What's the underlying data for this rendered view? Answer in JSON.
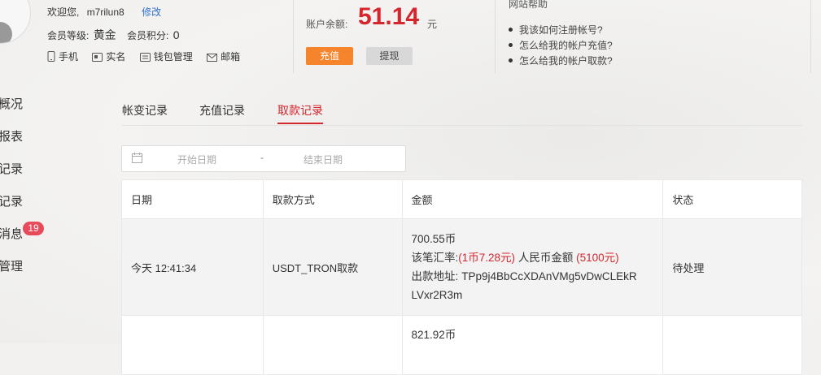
{
  "user": {
    "welcome": "欢迎您,",
    "username": "m7rilun8",
    "edit_link": "修改",
    "level_label": "会员等级:",
    "level_value": "黄金",
    "points_label": "会员积分:",
    "points_value": "0",
    "links": [
      "手机",
      "实名",
      "钱包管理",
      "邮箱"
    ]
  },
  "account": {
    "balance_label": "账户余额:",
    "balance_value": "51.14",
    "balance_unit": "元",
    "recharge_button": "充值",
    "withdraw_button": "提现"
  },
  "help": {
    "title": "网站帮助",
    "items": [
      "我该如何注册帐号?",
      "怎么给我的帐户充值?",
      "怎么给我的帐户取款?"
    ]
  },
  "sidebar": {
    "items": [
      "概况",
      "报表",
      "记录",
      "记录",
      "消息",
      "管理"
    ],
    "message_badge": "19"
  },
  "tabs": [
    "帐变记录",
    "充值记录",
    "取款记录"
  ],
  "active_tab": 2,
  "date_filter": {
    "start_placeholder": "开始日期",
    "separator": "-",
    "end_placeholder": "结束日期"
  },
  "table": {
    "headers": [
      "日期",
      "取款方式",
      "金额",
      "状态"
    ],
    "rows": [
      {
        "date": "今天 12:41:34",
        "method": "USDT_TRON取款",
        "amount_coins": "700.55币",
        "rate_label": "该笔汇率:",
        "rate_value": "(1币7.28元)",
        "rmb_label": "人民币金额",
        "rmb_value": "(5100元)",
        "address_label": "出款地址:",
        "address_part1": "TPp9j4BbCcXDAnVMg5vDwCLEkR",
        "address_part2": "LVxr2R3m",
        "status": "待处理"
      },
      {
        "date": "",
        "method": "",
        "amount_coins": "821.92币",
        "status": ""
      }
    ]
  },
  "colors": {
    "accent_red": "#d6262d",
    "recharge_orange": "#f5842d",
    "link_blue": "#2f6fd1",
    "badge_red": "#e8495b"
  }
}
